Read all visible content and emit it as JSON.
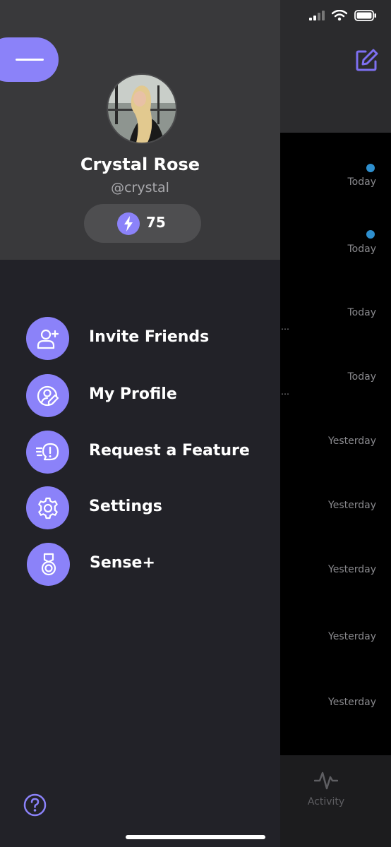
{
  "background_list": {
    "rows": [
      {
        "time": "Today",
        "unread": true
      },
      {
        "time": "Today",
        "unread": true
      },
      {
        "time": "Today",
        "unread": false
      },
      {
        "time": "Today",
        "unread": false
      },
      {
        "time": "Yesterday",
        "unread": false
      },
      {
        "time": "Yesterday",
        "unread": false
      },
      {
        "time": "Yesterday",
        "unread": false
      },
      {
        "time": "Yesterday",
        "unread": false
      },
      {
        "time": "Yesterday",
        "unread": false
      }
    ]
  },
  "tab_bar": {
    "activity_label": "Activity",
    "icon": "activity-icon"
  },
  "drawer": {
    "user": {
      "name": "Crystal Rose",
      "handle": "@crystal",
      "points": "75"
    },
    "menu": [
      {
        "label": "Invite Friends",
        "icon": "invite-user-icon"
      },
      {
        "label": "My Profile",
        "icon": "edit-profile-icon"
      },
      {
        "label": "Request a Feature",
        "icon": "request-feature-icon"
      },
      {
        "label": "Settings",
        "icon": "gear-icon"
      },
      {
        "label": "Sense+",
        "icon": "medal-icon"
      }
    ]
  },
  "colors": {
    "accent": "#8b82f9",
    "unread_dot": "#2e8fce",
    "drawer_bg": "#222228",
    "drawer_header_bg": "#39393b"
  }
}
